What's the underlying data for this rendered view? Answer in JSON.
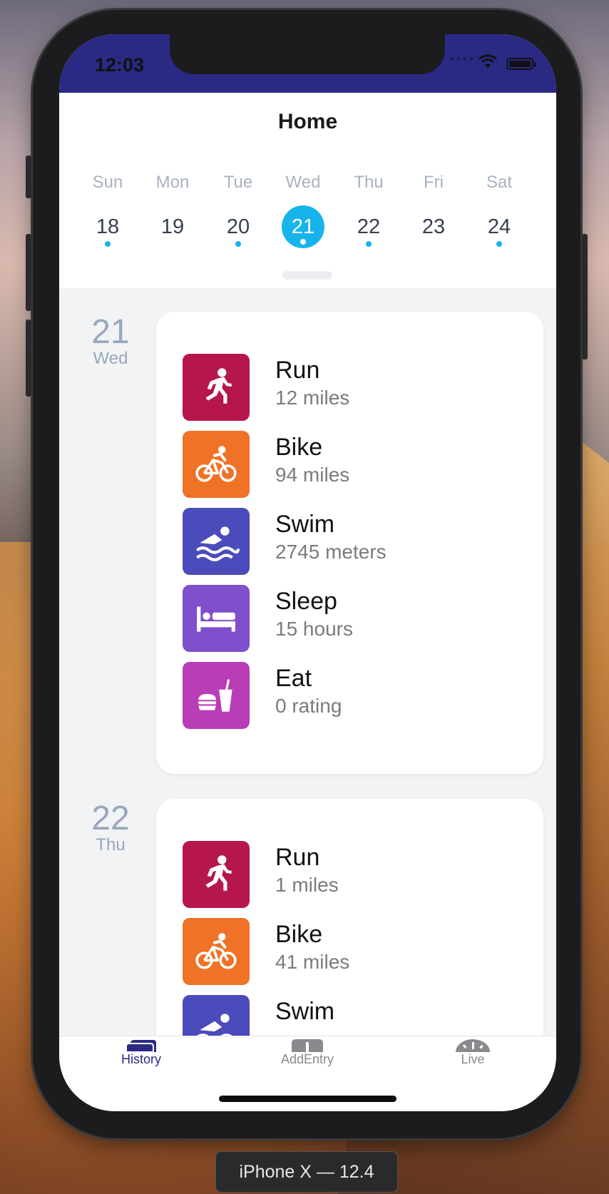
{
  "status_bar": {
    "time": "12:03"
  },
  "nav": {
    "title": "Home"
  },
  "calendar": {
    "days": [
      {
        "dow": "Sun",
        "date": "18",
        "has_entries": true,
        "selected": false
      },
      {
        "dow": "Mon",
        "date": "19",
        "has_entries": false,
        "selected": false
      },
      {
        "dow": "Tue",
        "date": "20",
        "has_entries": true,
        "selected": false
      },
      {
        "dow": "Wed",
        "date": "21",
        "has_entries": true,
        "selected": true
      },
      {
        "dow": "Thu",
        "date": "22",
        "has_entries": true,
        "selected": false
      },
      {
        "dow": "Fri",
        "date": "23",
        "has_entries": false,
        "selected": false
      },
      {
        "dow": "Sat",
        "date": "24",
        "has_entries": true,
        "selected": false
      }
    ],
    "accent": "#17b4ec"
  },
  "history": [
    {
      "day_number": "21",
      "day_name": "Wed",
      "entries": [
        {
          "title": "Run",
          "detail": "12 miles",
          "icon": "runner-icon",
          "color": "#b5174a"
        },
        {
          "title": "Bike",
          "detail": "94 miles",
          "icon": "cyclist-icon",
          "color": "#ef7226"
        },
        {
          "title": "Swim",
          "detail": "2745 meters",
          "icon": "swimmer-icon",
          "color": "#4b4bbc"
        },
        {
          "title": "Sleep",
          "detail": "15 hours",
          "icon": "bed-icon",
          "color": "#7f4fcc"
        },
        {
          "title": "Eat",
          "detail": "0 rating",
          "icon": "food-icon",
          "color": "#b83db6"
        }
      ]
    },
    {
      "day_number": "22",
      "day_name": "Thu",
      "entries": [
        {
          "title": "Run",
          "detail": "1 miles",
          "icon": "runner-icon",
          "color": "#b5174a"
        },
        {
          "title": "Bike",
          "detail": "41 miles",
          "icon": "cyclist-icon",
          "color": "#ef7226"
        },
        {
          "title": "Swim",
          "detail": "",
          "icon": "swimmer-icon",
          "color": "#4b4bbc"
        }
      ]
    }
  ],
  "tab_bar": {
    "tabs": [
      {
        "label": "History",
        "icon": "history-icon",
        "active": true
      },
      {
        "label": "AddEntry",
        "icon": "add-entry-icon",
        "active": false
      },
      {
        "label": "Live",
        "icon": "gauge-icon",
        "active": false
      }
    ],
    "active_color": "#2a2a85"
  },
  "device_label": "iPhone X — 12.4"
}
